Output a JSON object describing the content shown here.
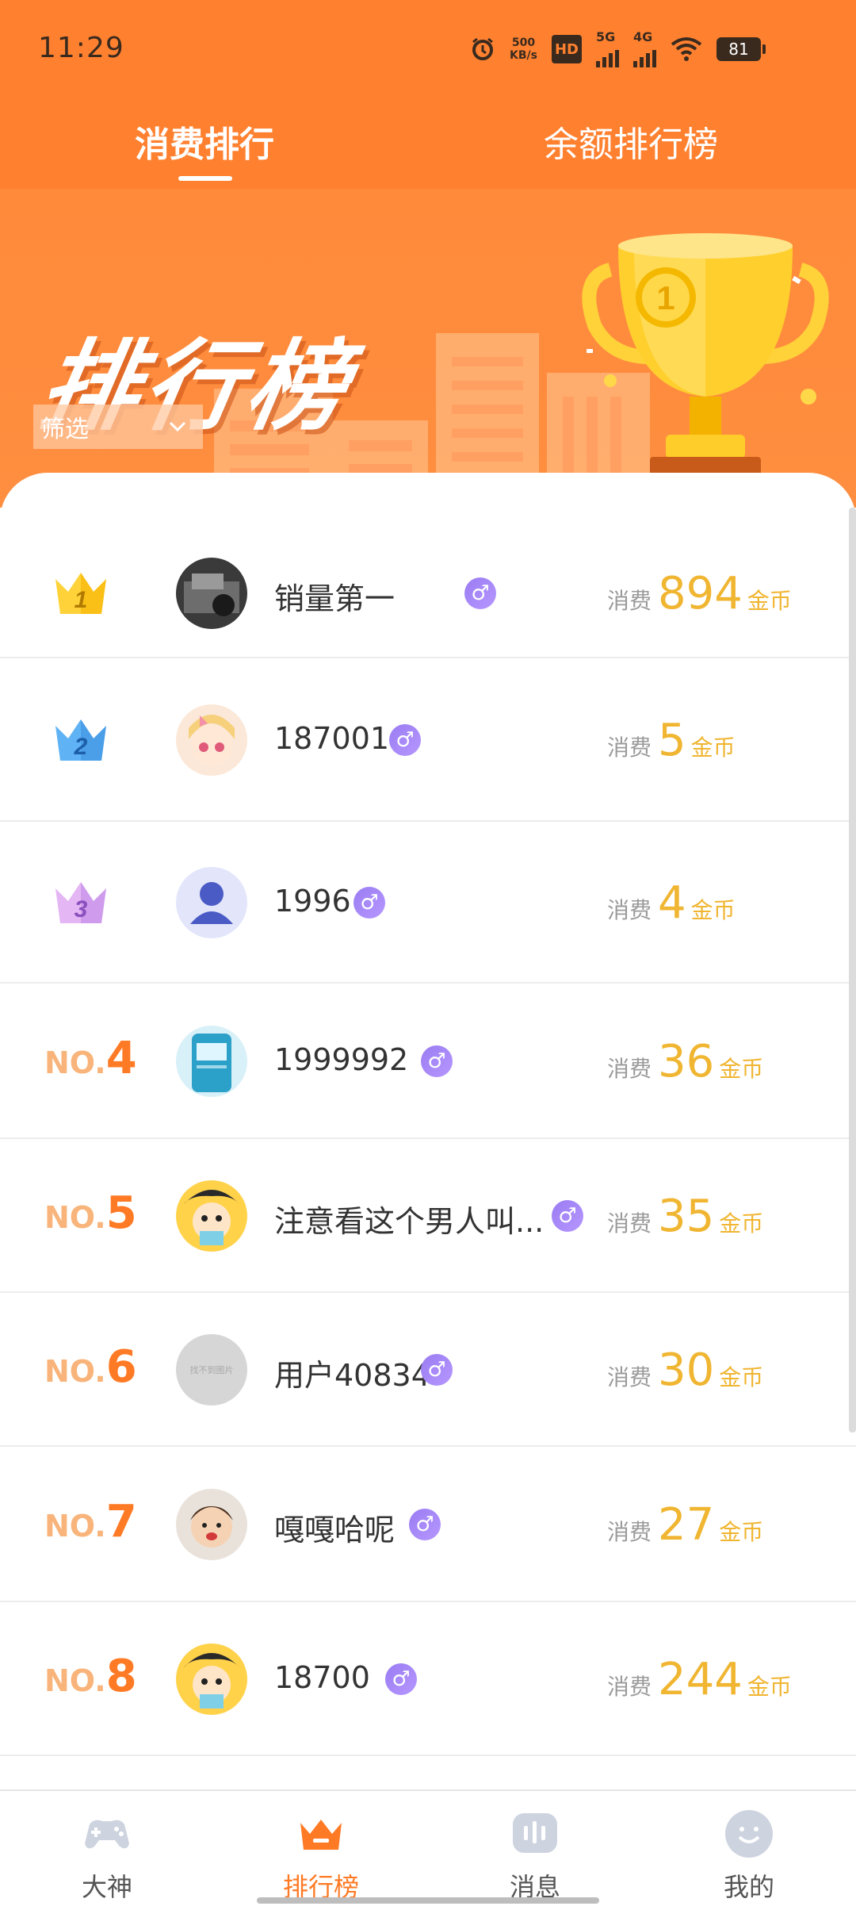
{
  "status_bar": {
    "time": "11:29",
    "net_speed_value": "500",
    "net_speed_unit": "KB/s",
    "hd_label": "HD",
    "sim1_label": "5G",
    "sim2_label": "4G",
    "battery": "81"
  },
  "tabs": [
    {
      "label": "消费排行",
      "active": true
    },
    {
      "label": "余额排行榜",
      "active": false
    }
  ],
  "hero": {
    "title": "排行榜",
    "filter_label": "筛选",
    "trophy_number": "1"
  },
  "spend_label": "消费",
  "currency": "金币",
  "rankings": [
    {
      "rank": "1",
      "name": "销量第一",
      "amount": "894",
      "avatar": "photo-avatar",
      "gender": "♂"
    },
    {
      "rank": "2",
      "name": "187001",
      "amount": "5",
      "avatar": "anime-girl-avatar",
      "gender": "♂"
    },
    {
      "rank": "3",
      "name": "1996",
      "amount": "4",
      "avatar": "default-user-avatar",
      "gender": "♂"
    },
    {
      "rank": "4",
      "name": "1999992",
      "amount": "36",
      "avatar": "device-avatar",
      "gender": "♂"
    },
    {
      "rank": "5",
      "name": "注意看这个男人叫...",
      "amount": "35",
      "avatar": "cartoon-avatar",
      "gender": "♂"
    },
    {
      "rank": "6",
      "name": "用户40834",
      "amount": "30",
      "avatar": "missing-image-avatar",
      "gender": "♂",
      "placeholder_text": "找不到图片"
    },
    {
      "rank": "7",
      "name": "嘎嘎哈呢",
      "amount": "27",
      "avatar": "child-photo-avatar",
      "gender": "♂"
    },
    {
      "rank": "8",
      "name": "18700",
      "amount": "244",
      "avatar": "cartoon-avatar",
      "gender": "♂"
    }
  ],
  "rank_prefix": "NO.",
  "bottom_nav": [
    {
      "label": "大神",
      "icon": "gamepad-icon",
      "active": false
    },
    {
      "label": "排行榜",
      "icon": "crown-icon",
      "active": true
    },
    {
      "label": "消息",
      "icon": "message-icon",
      "active": false
    },
    {
      "label": "我的",
      "icon": "smile-face-icon",
      "active": false
    }
  ],
  "colors": {
    "header_orange": "#ff8130",
    "accent_orange": "#ff7a25",
    "gold": "#f0b531",
    "gender_purple": "#9a7cf2"
  }
}
